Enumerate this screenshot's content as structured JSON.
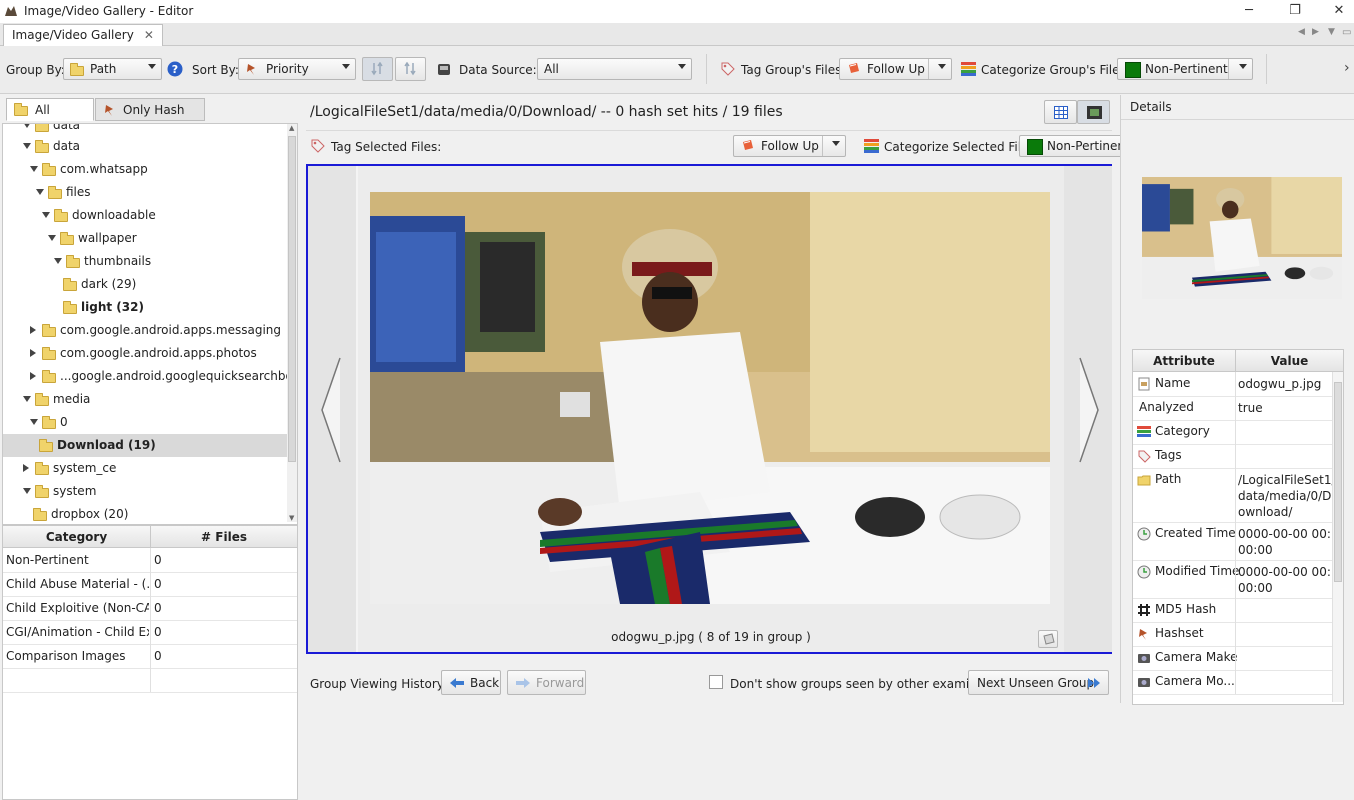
{
  "window": {
    "title": "Image/Video Gallery - Editor",
    "tab_label": "Image/Video Gallery",
    "minimize": "─",
    "maximize": "❐",
    "close": "✕"
  },
  "toolbar": {
    "group_by_label": "Group By:",
    "group_by_value": "Path",
    "sort_by_label": "Sort By:",
    "sort_by_value": "Priority",
    "data_source_label": "Data Source:",
    "data_source_value": "All",
    "tag_group_label": "Tag Group's Files:",
    "tag_group_value": "Follow Up",
    "categorize_group_label": "Categorize Group's Files:",
    "categorize_group_value": "Non-Pertinent",
    "accent_green": "#0a7a0a"
  },
  "left": {
    "tab_all_groups": "All Groups",
    "tab_hash_hits": "Only Hash Hits",
    "tree": [
      {
        "label": "data",
        "indent": 1,
        "expanded": true,
        "bold": false
      },
      {
        "label": "data",
        "indent": 1,
        "expanded": true,
        "bold": false
      },
      {
        "label": "com.whatsapp",
        "indent": 2,
        "expanded": true,
        "bold": false
      },
      {
        "label": "files",
        "indent": 3,
        "expanded": true,
        "bold": false
      },
      {
        "label": "downloadable",
        "indent": 4,
        "expanded": true,
        "bold": false
      },
      {
        "label": "wallpaper",
        "indent": 5,
        "expanded": true,
        "bold": false
      },
      {
        "label": "thumbnails",
        "indent": 6,
        "expanded": true,
        "bold": false
      },
      {
        "label": "dark (29)",
        "indent": 7,
        "leaf": true,
        "bold": false
      },
      {
        "label": "light (32)",
        "indent": 7,
        "leaf": true,
        "bold": true
      },
      {
        "label": "com.google.android.apps.messaging",
        "indent": 2,
        "expanded": false,
        "bold": false
      },
      {
        "label": "com.google.android.apps.photos",
        "indent": 2,
        "expanded": false,
        "bold": false
      },
      {
        "label": "...google.android.googlequicksearchbox",
        "indent": 2,
        "expanded": false,
        "bold": false
      },
      {
        "label": "media",
        "indent": 1,
        "expanded": true,
        "bold": false
      },
      {
        "label": "0",
        "indent": 2,
        "expanded": true,
        "bold": false
      },
      {
        "label": "Download (19)",
        "indent": 3,
        "leaf": true,
        "bold": true,
        "selected": true
      },
      {
        "label": "system_ce",
        "indent": 1,
        "expanded": false,
        "bold": false
      },
      {
        "label": "system",
        "indent": 1,
        "expanded": true,
        "bold": false
      },
      {
        "label": "dropbox (20)",
        "indent": 2,
        "leaf": true,
        "bold": false
      }
    ],
    "category_header": "Category",
    "files_header": "# Files",
    "categories": [
      {
        "name": "Non-Pertinent",
        "count": "0"
      },
      {
        "name": "Child Abuse Material - (...",
        "count": "0"
      },
      {
        "name": "Child Exploitive (Non-CA...",
        "count": "0"
      },
      {
        "name": "CGI/Animation - Child Ex...",
        "count": "0"
      },
      {
        "name": "Comparison Images",
        "count": "0"
      }
    ]
  },
  "center": {
    "path_text": "/LogicalFileSet1/data/media/0/Download/ -- 0 hash set hits / 19 files",
    "tag_selected_label": "Tag Selected Files:",
    "tag_selected_value": "Follow Up",
    "categorize_selected_label": "Categorize Selected File:",
    "categorize_selected_value": "Non-Pertinent",
    "caption": "odogwu_p.jpg  ( 8 of 19 in group )",
    "history_label": "Group Viewing History:",
    "back_label": "Back",
    "forward_label": "Forward",
    "dont_show_label": "Don't show groups seen by other examiners",
    "next_unseen_label": "Next Unseen Group"
  },
  "right": {
    "details_label": "Details",
    "attribute_header": "Attribute",
    "value_header": "Value",
    "rows": [
      {
        "key": "Name",
        "value": "odogwu_p.jpg",
        "icon": "file-icon"
      },
      {
        "key": "Analyzed",
        "value": "true",
        "icon": ""
      },
      {
        "key": "Category",
        "value": "",
        "icon": "category-icon"
      },
      {
        "key": "Tags",
        "value": "",
        "icon": "tag-icon"
      },
      {
        "key": "Path",
        "value": "/LogicalFileSet1/data/media/0/Download/",
        "icon": "folder-icon"
      },
      {
        "key": "Created Time",
        "value": "0000-00-00 00:00:00",
        "icon": "clock-icon"
      },
      {
        "key": "Modified Time",
        "value": "0000-00-00 00:00:00",
        "icon": "clock-icon"
      },
      {
        "key": "MD5 Hash",
        "value": "",
        "icon": "hash-icon"
      },
      {
        "key": "Hashset",
        "value": "",
        "icon": "hashset-icon"
      },
      {
        "key": "Camera Make",
        "value": "",
        "icon": "camera-icon"
      },
      {
        "key": "Camera Mo...",
        "value": "",
        "icon": "camera-icon"
      }
    ]
  }
}
